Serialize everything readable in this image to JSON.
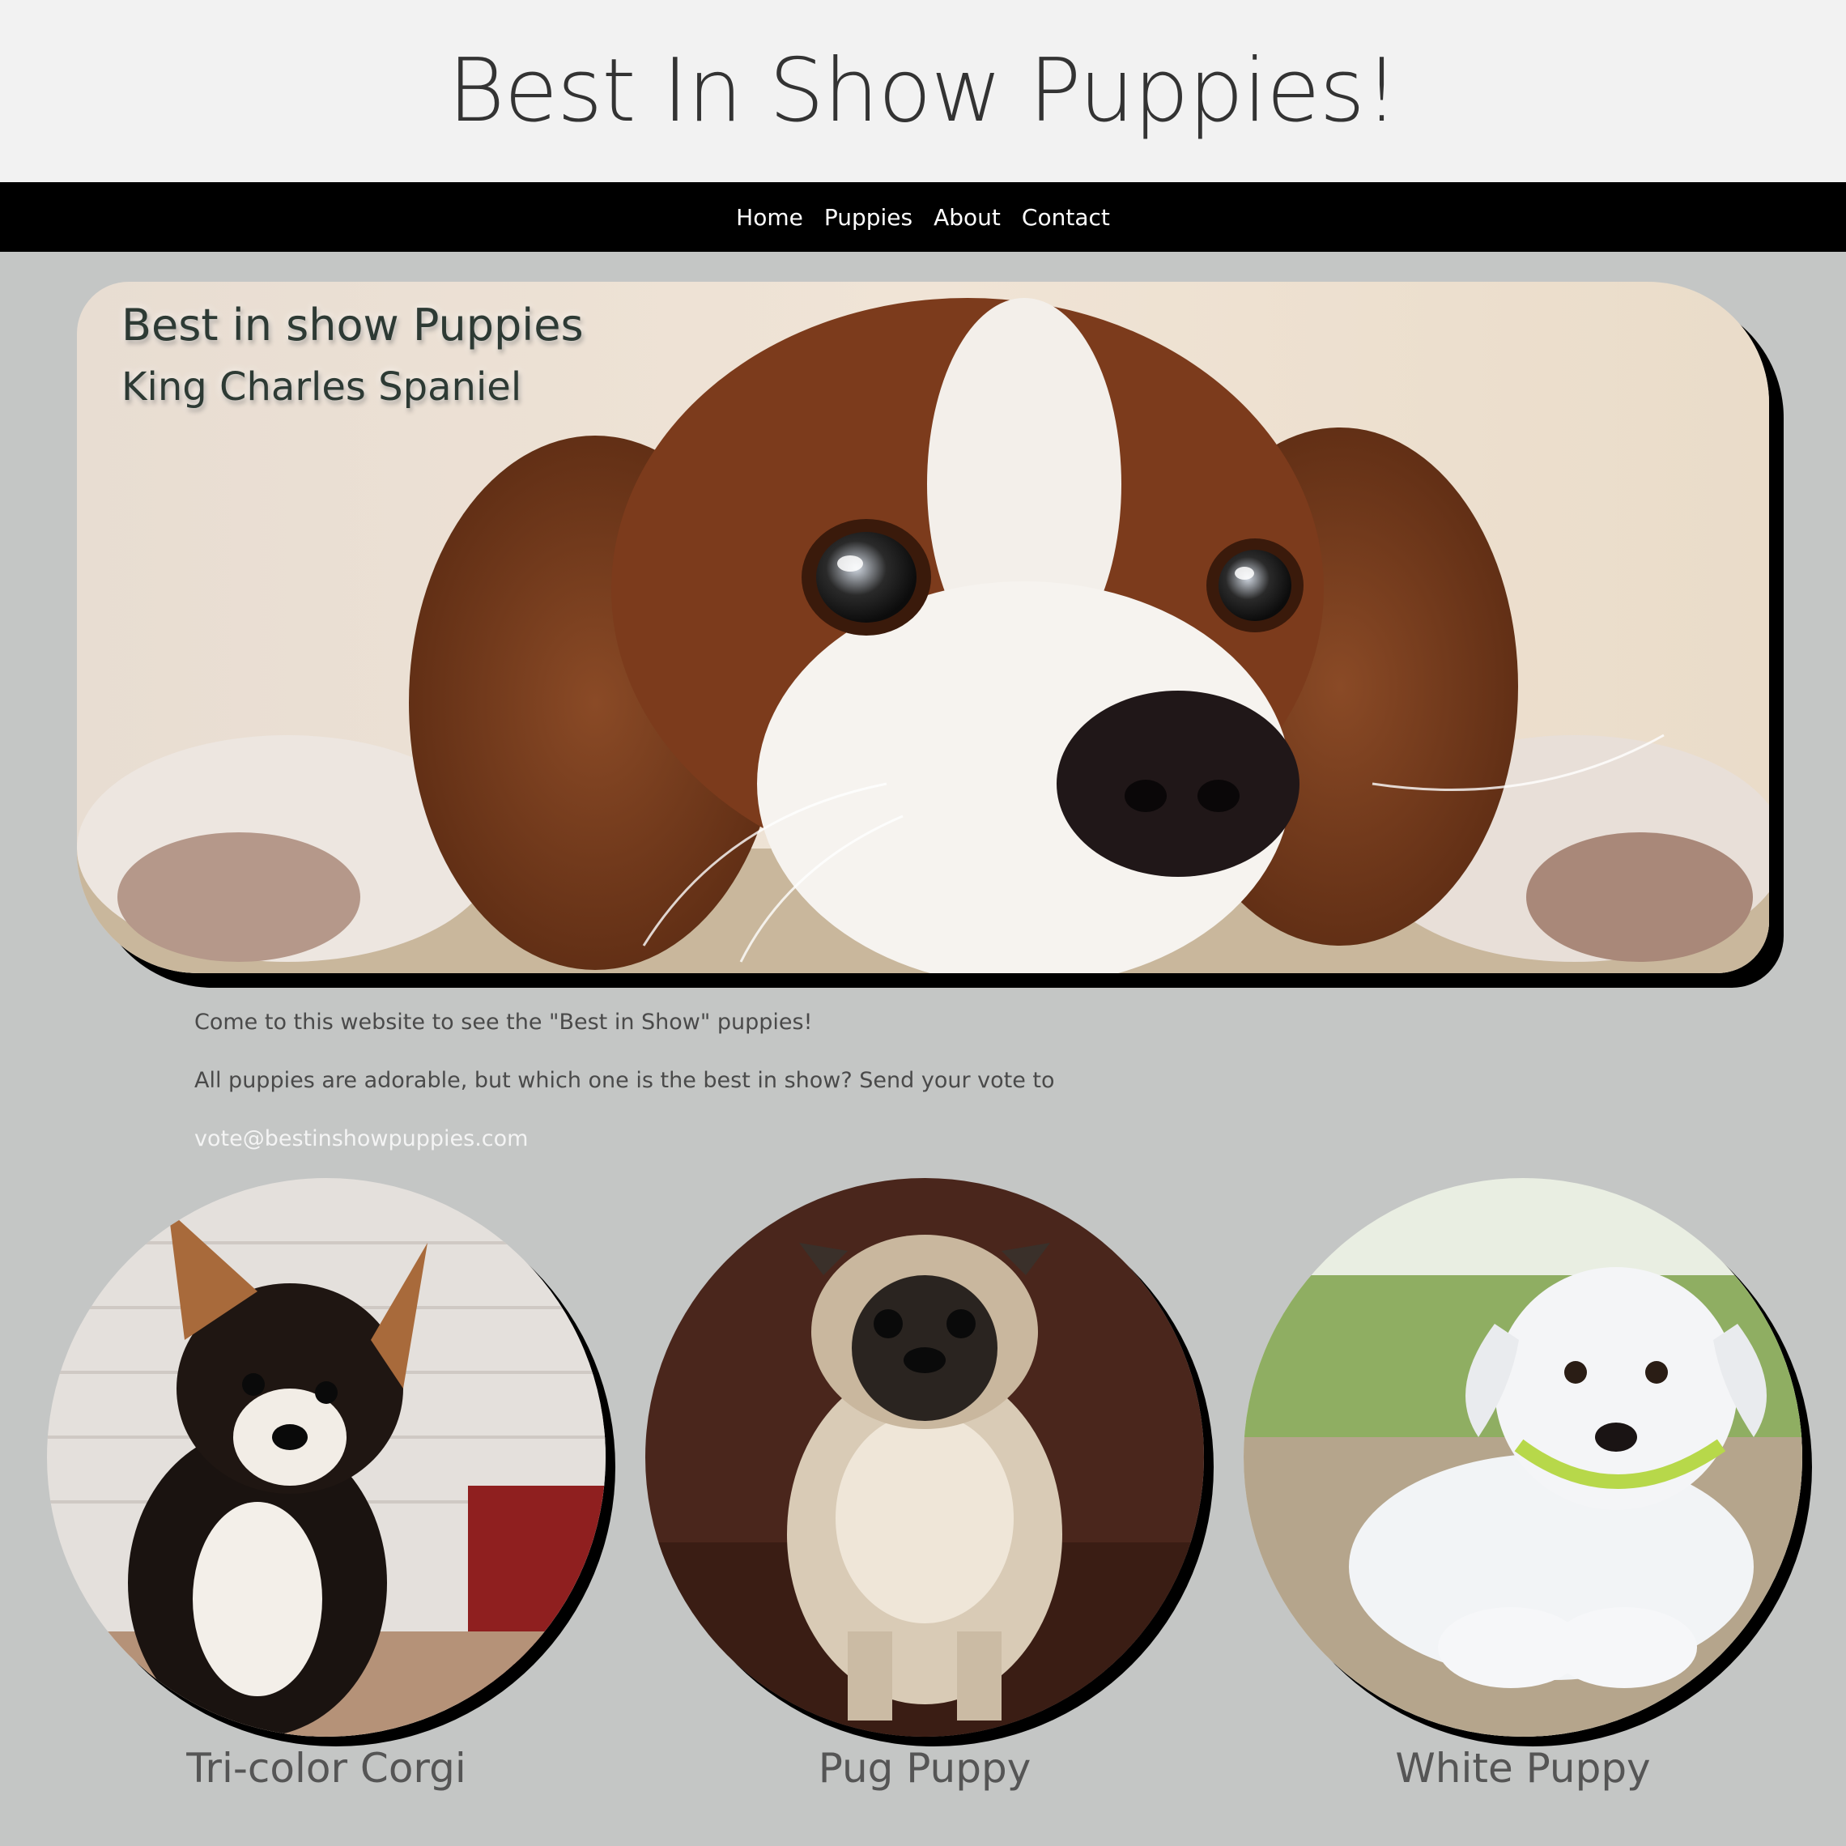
{
  "header": {
    "title": "Best In Show Puppies!"
  },
  "nav": {
    "items": [
      "Home",
      "Puppies",
      "About",
      "Contact"
    ]
  },
  "hero": {
    "title": "Best in show Puppies",
    "subtitle": "King Charles Spaniel"
  },
  "intro": {
    "line1": "Come to this website to see the \"Best in Show\" puppies!",
    "line2": "All puppies are adorable, but which one is the best in show? Send your vote to",
    "email": "vote@bestinshowpuppies.com"
  },
  "puppies": [
    {
      "caption": "Tri-color Corgi"
    },
    {
      "caption": "Pug Puppy"
    },
    {
      "caption": "White Puppy"
    }
  ],
  "colors": {
    "page_background": "#c4c6c5",
    "header_background": "#f2f2f2",
    "nav_background": "#000000"
  }
}
